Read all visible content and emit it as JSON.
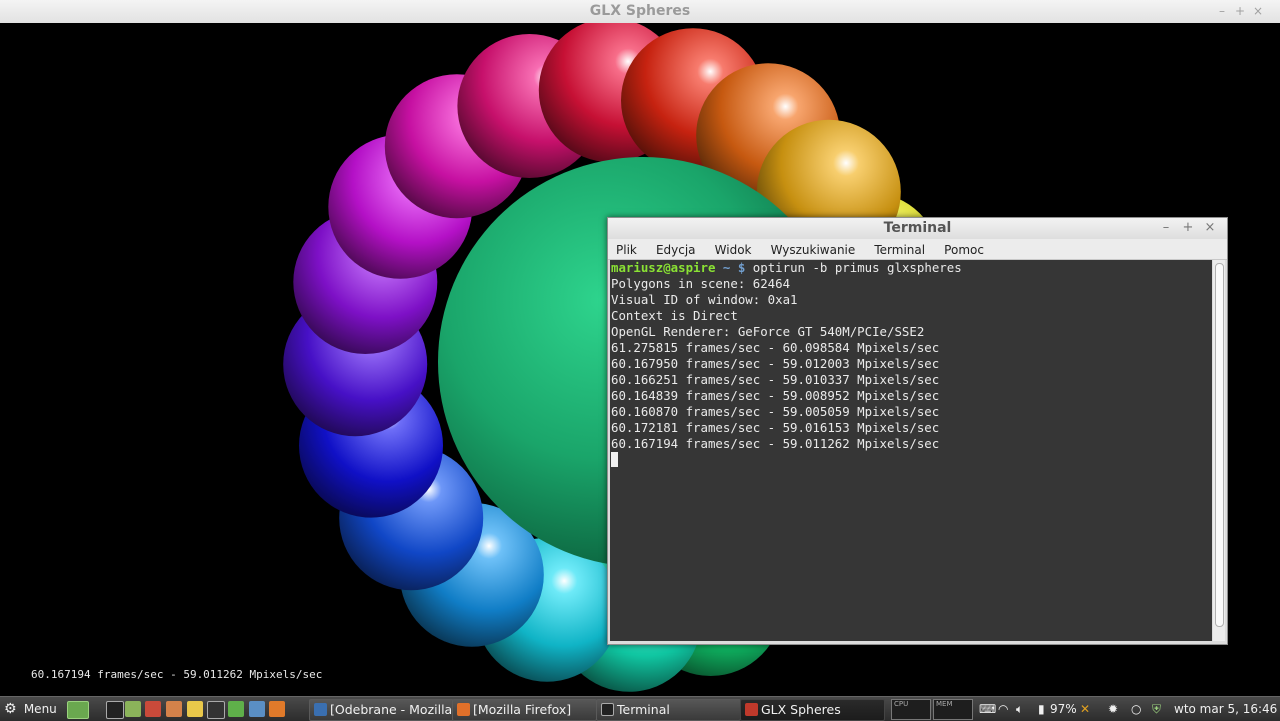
{
  "glx_window": {
    "title": "GLX Spheres",
    "controls": [
      "–",
      "+",
      "×"
    ],
    "fps_overlay": "60.167194 frames/sec - 59.011262 Mpixels/sec"
  },
  "terminal": {
    "title": "Terminal",
    "controls": [
      "–",
      "+",
      "×"
    ],
    "menu": [
      "Plik",
      "Edycja",
      "Widok",
      "Wyszukiwanie",
      "Terminal",
      "Pomoc"
    ],
    "prompt_user": "mariusz@aspire",
    "prompt_path": "~",
    "prompt_symbol": "$",
    "command": "optirun -b primus glxspheres",
    "output": [
      "Polygons in scene: 62464",
      "Visual ID of window: 0xa1",
      "Context is Direct",
      "OpenGL Renderer: GeForce GT 540M/PCIe/SSE2",
      "61.275815 frames/sec - 60.098584 Mpixels/sec",
      "60.167950 frames/sec - 59.012003 Mpixels/sec",
      "60.166251 frames/sec - 59.010337 Mpixels/sec",
      "60.164839 frames/sec - 59.008952 Mpixels/sec",
      "60.160870 frames/sec - 59.005059 Mpixels/sec",
      "60.172181 frames/sec - 59.016153 Mpixels/sec",
      "60.167194 frames/sec - 59.011262 Mpixels/sec"
    ]
  },
  "taskbar": {
    "menu_label": "Menu",
    "tasks": [
      {
        "label": "[Odebrane - Mozilla...",
        "icon_color": "#3a6fb0"
      },
      {
        "label": "[Mozilla Firefox]",
        "icon_color": "#e0702a"
      },
      {
        "label": "Terminal",
        "icon_color": "#222222"
      },
      {
        "label": "GLX Spheres",
        "icon_color": "#c0392b"
      }
    ],
    "graph_labels": [
      "CPU",
      "MEM"
    ],
    "battery": "97%",
    "clock": "wto mar  5, 16:46"
  }
}
